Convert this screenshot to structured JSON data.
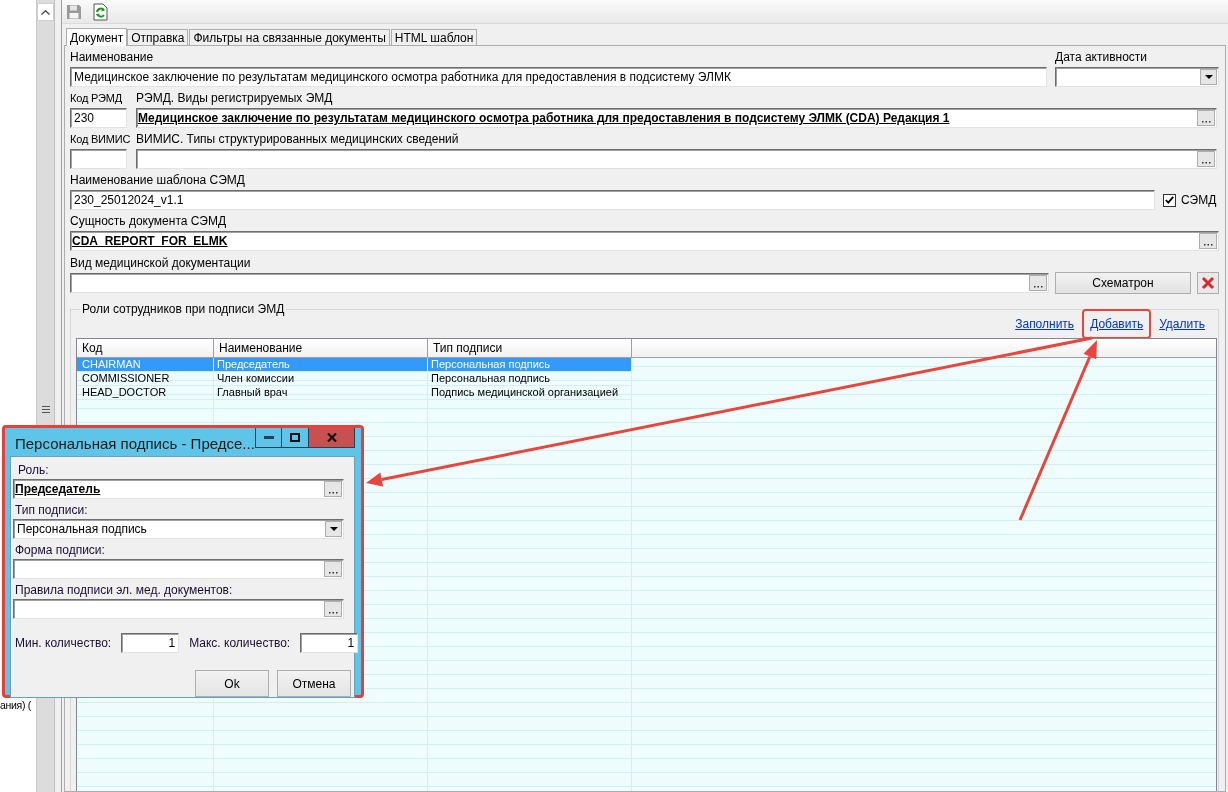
{
  "toolbar": [
    {
      "kind": "save",
      "disabled": true
    },
    {
      "kind": "refresh",
      "disabled": false
    }
  ],
  "left_pane": {
    "text": "ания) ("
  },
  "tabs": [
    {
      "label": "Документ",
      "selected": true
    },
    {
      "label": "Отправка",
      "selected": false
    },
    {
      "label": "Фильтры на связанные документы",
      "selected": false
    },
    {
      "label": "HTML шаблон",
      "selected": false
    }
  ],
  "form": {
    "name": {
      "label": "Наименование",
      "kind": "text",
      "value": "Медицинское заключение по результатам медицинского осмотра работника для предоставления в подсистему ЭЛМК"
    },
    "activity_date": {
      "label": "Дата активности",
      "kind": "combo"
    },
    "remd_code": {
      "label": "Код РЭМД",
      "kind": "text",
      "value": "230"
    },
    "remd_type": {
      "label": "РЭМД. Виды регистрируемых ЭМД",
      "kind": "lookup",
      "value": "Медицинское заключение по результатам медицинского осмотра работника для предоставления в подсистему ЭЛМК (CDA) Редакция 1"
    },
    "vimis_code": {
      "label": "Код ВИМИС",
      "kind": "text"
    },
    "vimis_type": {
      "label": "ВИМИС. Типы структурированных медицинских сведений",
      "kind": "lookup"
    },
    "template_name": {
      "label": "Наименование шаблона СЭМД",
      "kind": "text",
      "value": "230_25012024_v1.1"
    },
    "semd": {
      "label": "СЭМД",
      "checked": true
    },
    "entity": {
      "label": "Сущность документа СЭМД",
      "kind": "lookup",
      "value": "CDA_REPORT_FOR_ELMK"
    },
    "doc_kind": {
      "label": "Вид медицинской документации",
      "kind": "lookup"
    },
    "schematron_button": "Схематрон"
  },
  "roles": {
    "title": "Роли сотрудников при подписи ЭМД",
    "links": [
      {
        "label": "Заполнить",
        "highlighted": false
      },
      {
        "label": "Добавить",
        "highlighted": true
      },
      {
        "label": "Удалить",
        "highlighted": false
      }
    ],
    "columns": [
      "Код",
      "Наименование",
      "Тип подписи"
    ],
    "rows": [
      {
        "cells": [
          "CHAIRMAN",
          "Председатель",
          "Персональная подпись"
        ],
        "selected": true
      },
      {
        "cells": [
          "COMMISSIONER",
          "Член комиссии",
          "Персональная подпись"
        ],
        "selected": false
      },
      {
        "cells": [
          "HEAD_DOCTOR",
          "Главный врач",
          "Подпись медицинской организацией"
        ],
        "selected": false
      }
    ]
  },
  "dialog": {
    "title": "Персональная подпись - Предсе...",
    "role": {
      "label": "Роль:",
      "kind": "lookup",
      "value": "Председатель"
    },
    "sign_type": {
      "label": "Тип подписи:",
      "kind": "combo",
      "value": "Персональная подпись"
    },
    "sign_form": {
      "label": "Форма подписи:",
      "kind": "lookup"
    },
    "sign_rules": {
      "label": "Правила подписи эл. мед. документов:",
      "kind": "lookup"
    },
    "min_count": {
      "label": "Мин. количество:",
      "kind": "number",
      "value": "1"
    },
    "max_count": {
      "label": "Макс. количество:",
      "kind": "number",
      "value": "1"
    },
    "buttons": [
      "Ok",
      "Отмена"
    ]
  }
}
